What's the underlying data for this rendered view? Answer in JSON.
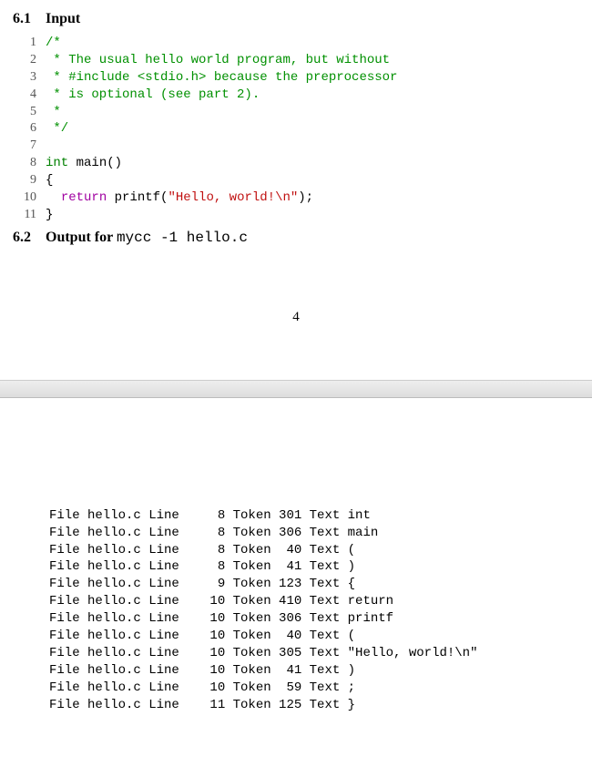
{
  "sections": {
    "input": {
      "num": "6.1",
      "title": "Input"
    },
    "output": {
      "num": "6.2",
      "title_prefix": "Output for ",
      "cmd": "mycc -1 hello.c"
    }
  },
  "pagenum": "4",
  "code": {
    "lines": [
      {
        "n": "1",
        "tokens": [
          {
            "cls": "tok-comment",
            "t": "/*"
          }
        ]
      },
      {
        "n": "2",
        "tokens": [
          {
            "cls": "tok-comment",
            "t": " * The usual hello world program, but without"
          }
        ]
      },
      {
        "n": "3",
        "tokens": [
          {
            "cls": "tok-comment",
            "t": " * #include <stdio.h> because the preprocessor"
          }
        ]
      },
      {
        "n": "4",
        "tokens": [
          {
            "cls": "tok-comment",
            "t": " * is optional (see part 2)."
          }
        ]
      },
      {
        "n": "5",
        "tokens": [
          {
            "cls": "tok-comment",
            "t": " *"
          }
        ]
      },
      {
        "n": "6",
        "tokens": [
          {
            "cls": "tok-comment",
            "t": " */"
          }
        ]
      },
      {
        "n": "7",
        "tokens": []
      },
      {
        "n": "8",
        "tokens": [
          {
            "cls": "tok-kw-type",
            "t": "int"
          },
          {
            "cls": "tok-plain",
            "t": " main()"
          }
        ]
      },
      {
        "n": "9",
        "tokens": [
          {
            "cls": "tok-plain",
            "t": "{"
          }
        ]
      },
      {
        "n": "10",
        "tokens": [
          {
            "cls": "tok-plain",
            "t": "  "
          },
          {
            "cls": "tok-kw",
            "t": "return"
          },
          {
            "cls": "tok-plain",
            "t": " printf("
          },
          {
            "cls": "tok-string",
            "t": "\"Hello, world!\\n\""
          },
          {
            "cls": "tok-plain",
            "t": ");"
          }
        ]
      },
      {
        "n": "11",
        "tokens": [
          {
            "cls": "tok-plain",
            "t": "}"
          }
        ]
      }
    ]
  },
  "output": {
    "file_label": "File",
    "filename": "hello.c",
    "line_label": "Line",
    "token_label": "Token",
    "text_label": "Text",
    "rows": [
      {
        "line": 8,
        "token": 301,
        "text": "int"
      },
      {
        "line": 8,
        "token": 306,
        "text": "main"
      },
      {
        "line": 8,
        "token": 40,
        "text": "("
      },
      {
        "line": 8,
        "token": 41,
        "text": ")"
      },
      {
        "line": 9,
        "token": 123,
        "text": "{"
      },
      {
        "line": 10,
        "token": 410,
        "text": "return"
      },
      {
        "line": 10,
        "token": 306,
        "text": "printf"
      },
      {
        "line": 10,
        "token": 40,
        "text": "("
      },
      {
        "line": 10,
        "token": 305,
        "text": "\"Hello, world!\\n\""
      },
      {
        "line": 10,
        "token": 41,
        "text": ")"
      },
      {
        "line": 10,
        "token": 59,
        "text": ";"
      },
      {
        "line": 11,
        "token": 125,
        "text": "}"
      }
    ]
  }
}
